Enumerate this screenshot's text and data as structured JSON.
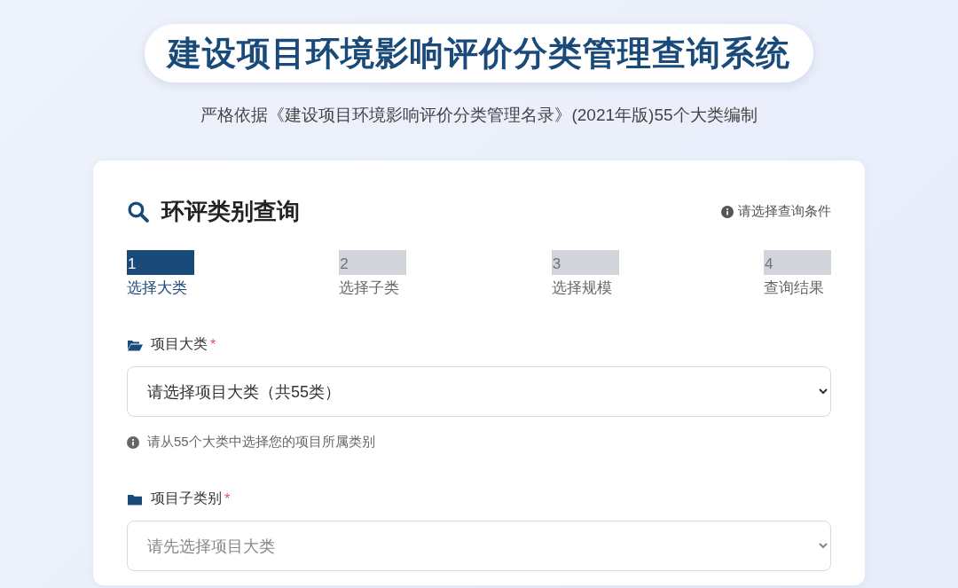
{
  "header": {
    "title": "建设项目环境影响评价分类管理查询系统",
    "subtitle": "严格依据《建设项目环境影响评价分类管理名录》(2021年版)55个大类编制"
  },
  "card": {
    "heading": "环评类别查询",
    "hint": "请选择查询条件",
    "steps": [
      {
        "number": "1",
        "label": "选择大类",
        "selected": true
      },
      {
        "number": "2",
        "label": "选择子类",
        "selected": false
      },
      {
        "number": "3",
        "label": "选择规模",
        "selected": false
      },
      {
        "number": "4",
        "label": "查询结果",
        "selected": false
      }
    ],
    "fields": [
      {
        "kind": "open",
        "label": "项目大类",
        "required_mark": "*",
        "value": "请选择项目大类（共55类）",
        "disabled": false,
        "help": "请从55个大类中选择您的项目所属类别"
      },
      {
        "kind": "closed",
        "label": "项目子类别",
        "required_mark": "*",
        "value": "请先选择项目大类",
        "disabled": true
      }
    ]
  }
}
